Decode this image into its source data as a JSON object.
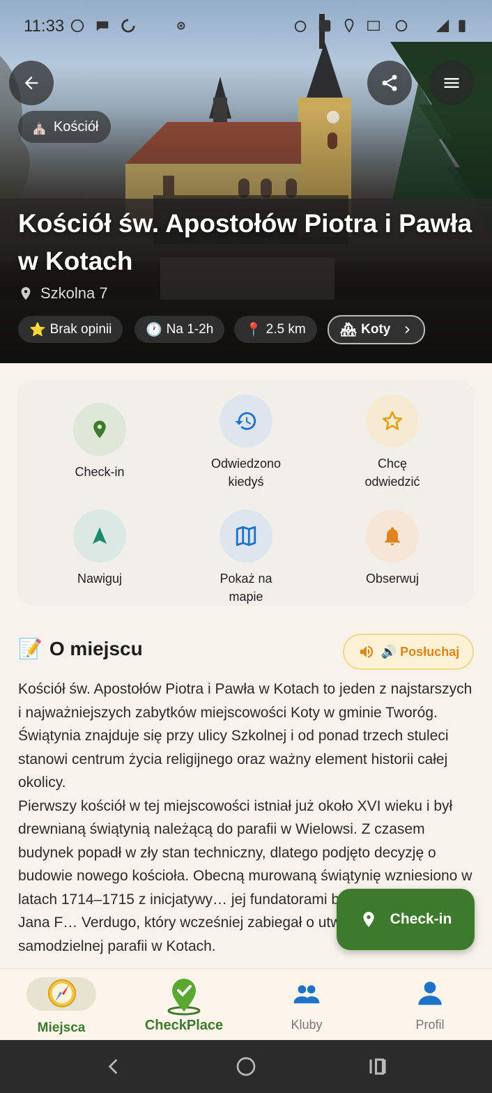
{
  "status_bar": {
    "time": "11:33"
  },
  "hero": {
    "category": "Kościół",
    "category_icon": "⛪",
    "title": "Kościół św. Apostołów Piotra i Pawła w Kotach",
    "address": "Szkolna 7",
    "pills": [
      {
        "icon": "⭐",
        "label": "Brak opinii"
      },
      {
        "icon": "🕐",
        "label": "Na 1-2h"
      },
      {
        "icon": "📍",
        "label": "2.5 km"
      }
    ],
    "town": {
      "icon": "🏘",
      "label": "Koty"
    }
  },
  "actions": [
    {
      "label": "Check-in",
      "icon": "map-pin-icon",
      "bg": "#dfe7d8",
      "color": "#3e7a2c"
    },
    {
      "label": "Odwiedzono kiedyś",
      "icon": "history-icon",
      "bg": "#dde6ef",
      "color": "#1e73c8"
    },
    {
      "label": "Chcę odwiedzić",
      "icon": "star-icon",
      "bg": "#f6ead3",
      "color": "#e2a21a"
    },
    {
      "label": "Nawiguj",
      "icon": "navigation-arrow-icon",
      "bg": "#dbe8e3",
      "color": "#1b8a6c"
    },
    {
      "label": "Pokaż na mapie",
      "icon": "map-icon",
      "bg": "#dde6ef",
      "color": "#1e73c8"
    },
    {
      "label": "Obserwuj",
      "icon": "bell-icon",
      "bg": "#f6e6d6",
      "color": "#e0821d"
    }
  ],
  "about": {
    "emoji": "📝",
    "title": "O miejscu",
    "listen_label": "🔊 Posłuchaj",
    "text": "Kościół św. Apostołów Piotra i Pawła w Kotach to jeden z najstarszych i najważniejszych zabytków miejscowości Koty w gminie Tworóg. Świątynia znajduje się przy ulicy Szkolnej i od ponad trzech stuleci stanowi centrum życia religijnego oraz ważny element historii całej okolicy.\nPierwszy kościół w tej miejscowości istniał już około XVI wieku i był drewnianą świątynią należącą do parafii w Wielowsi. Z czasem budynek popadł w zły stan techniczny, dlatego podjęto decyzję o budowie nowego kościoła. Obecną murowaną świątynię wzniesiono w latach 1714–1715 z inicjatywy… jej fundatorami byli synowie hrabiego Jana F… Verdugo, który wcześniej zabiegał o utworzenie samodzielnej parafii w Kotach."
  },
  "fab": {
    "label": "Check-in"
  },
  "bottom_nav": [
    {
      "label": "Miejsca",
      "active": true
    },
    {
      "label": "CheckPlace",
      "brand": true
    },
    {
      "label": "Kluby"
    },
    {
      "label": "Profil"
    }
  ],
  "colors": {
    "accent_green": "#3e7a2c",
    "accent_orange": "#e08414",
    "background": "#f7f3ec"
  }
}
